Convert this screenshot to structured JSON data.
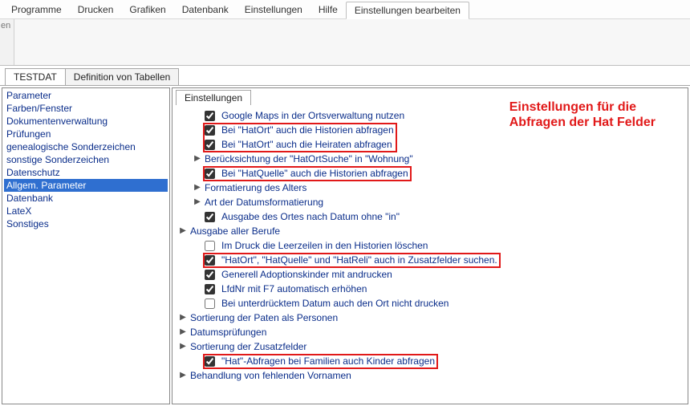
{
  "menu": {
    "items": [
      "Programme",
      "Drucken",
      "Grafiken",
      "Datenbank",
      "Einstellungen",
      "Hilfe",
      "Einstellungen bearbeiten"
    ],
    "active_index": 6
  },
  "toolbar_fragment": "en",
  "main_tabs": {
    "items": [
      "TESTDAT",
      "Definition von Tabellen"
    ],
    "active_index": 0
  },
  "sidebar": {
    "items": [
      "Parameter",
      "Farben/Fenster",
      "Dokumentenverwaltung",
      "Prüfungen",
      "genealogische Sonderzeichen",
      "sonstige Sonderzeichen",
      "Datenschutz",
      "Allgem. Parameter",
      "Datenbank",
      "LateX",
      "Sonstiges"
    ],
    "selected_index": 7
  },
  "tree_tab": "Einstellungen",
  "tree": [
    {
      "type": "check",
      "checked": true,
      "label": "Google Maps in der Ortsverwaltung nutzen"
    },
    {
      "type": "check",
      "checked": true,
      "label": "Bei \"HatOrt\" auch die Historien abfragen",
      "highlight": 1
    },
    {
      "type": "check",
      "checked": true,
      "label": "Bei \"HatOrt\" auch die Heiraten abfragen",
      "highlight": 1
    },
    {
      "type": "group",
      "label": "Berücksichtung der \"HatOrtSuche\" in \"Wohnung\""
    },
    {
      "type": "check",
      "checked": true,
      "label": "Bei \"HatQuelle\" auch die Historien abfragen",
      "highlight": 2
    },
    {
      "type": "group",
      "label": "Formatierung des Alters"
    },
    {
      "type": "group",
      "label": "Art der Datumsformatierung"
    },
    {
      "type": "check",
      "checked": true,
      "label": "Ausgabe des Ortes nach Datum ohne \"in\""
    },
    {
      "type": "group",
      "label": "Ausgabe aller Berufe",
      "outdent": true
    },
    {
      "type": "check",
      "checked": false,
      "label": "Im Druck die Leerzeilen in den Historien löschen"
    },
    {
      "type": "check",
      "checked": true,
      "label": "\"HatOrt\", \"HatQuelle\" und \"HatReli\" auch in Zusatzfelder suchen.",
      "highlight": 3
    },
    {
      "type": "check",
      "checked": true,
      "label": "Generell Adoptionskinder mit andrucken"
    },
    {
      "type": "check",
      "checked": true,
      "label": "LfdNr mit F7 automatisch erhöhen"
    },
    {
      "type": "check",
      "checked": false,
      "label": "Bei unterdrücktem Datum auch den Ort nicht drucken"
    },
    {
      "type": "group",
      "label": "Sortierung der Paten als Personen",
      "outdent": true
    },
    {
      "type": "group",
      "label": "Datumsprüfungen",
      "outdent": true
    },
    {
      "type": "group",
      "label": "Sortierung der Zusatzfelder",
      "outdent": true
    },
    {
      "type": "check",
      "checked": true,
      "label": "\"Hat\"-Abfragen bei Familien auch Kinder abfragen",
      "highlight": 4
    },
    {
      "type": "group",
      "label": "Behandlung von fehlenden Vornamen",
      "outdent": true
    }
  ],
  "annotation": {
    "line1": "Einstellungen für die",
    "line2": "Abfragen der Hat Felder"
  }
}
